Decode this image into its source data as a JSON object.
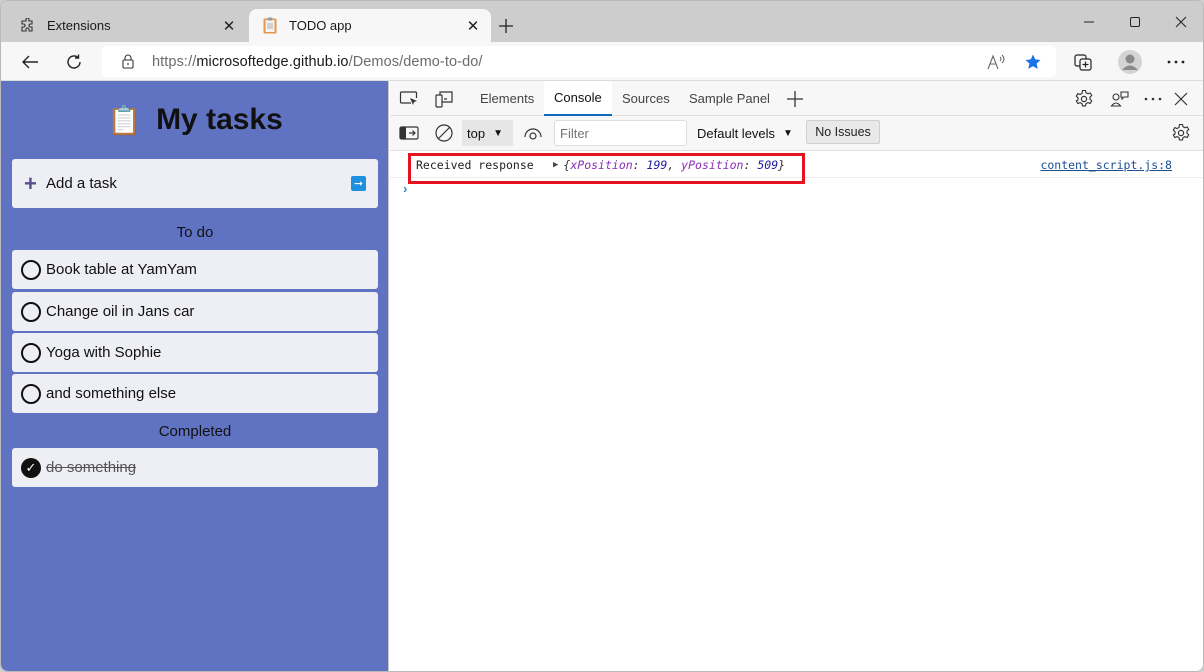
{
  "browser": {
    "tabs": [
      {
        "title": "Extensions",
        "icon": "puzzle-icon",
        "active": false
      },
      {
        "title": "TODO app",
        "icon": "clipboard-icon",
        "active": true
      }
    ],
    "address": {
      "url_prefix": "https://",
      "url_domain": "microsoftedge.github.io",
      "url_path": "/Demos/demo-to-do/"
    }
  },
  "page": {
    "title": "My tasks",
    "title_emoji": "📋",
    "add_task_label": "Add a task",
    "todo_heading": "To do",
    "completed_heading": "Completed",
    "todo_items": [
      {
        "text": "Book table at YamYam",
        "done": false
      },
      {
        "text": "Change oil in Jans car",
        "done": false
      },
      {
        "text": "Yoga with Sophie",
        "done": false
      },
      {
        "text": "and something else",
        "done": false
      }
    ],
    "completed_items": [
      {
        "text": "do something",
        "done": true
      }
    ],
    "colors": {
      "background": "#5f73c2",
      "card": "#eeeff4"
    }
  },
  "devtools": {
    "tabs": [
      "Elements",
      "Console",
      "Sources",
      "Sample Panel"
    ],
    "active_tab": "Console",
    "toolbar": {
      "context": "top",
      "filter_placeholder": "Filter",
      "levels": "Default levels",
      "issues": "No Issues"
    },
    "console": {
      "message": "Received response",
      "object": {
        "open": "{",
        "key1": "xPosition",
        "value1": "199",
        "sep": ", ",
        "key2": "yPosition",
        "value2": "509",
        "close": "}"
      },
      "source": "content_script.js:8",
      "prompt": "›"
    },
    "highlight_color": "#e5121f"
  }
}
